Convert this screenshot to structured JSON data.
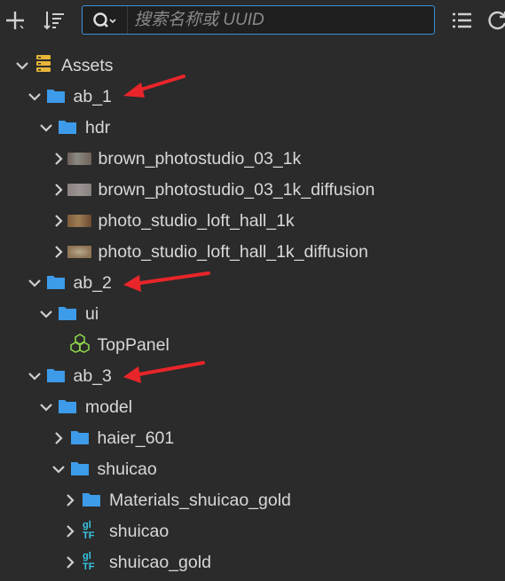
{
  "toolbar": {
    "add_icon": "plus-icon",
    "sort_icon": "sort-icon",
    "search_placeholder": "搜索名称或 UUID",
    "list_icon": "list-icon",
    "refresh_icon": "refresh-icon"
  },
  "colors": {
    "background": "#2b2b2b",
    "folder": "#3d9be9",
    "search_border": "#3c8fd6",
    "annotation_arrow": "#e8252a",
    "prefab": "#8bd34a",
    "gltf": "#37c6e6"
  },
  "tree": [
    {
      "label": "Assets",
      "icon": "database-icon",
      "expanded": true,
      "level": 0
    },
    {
      "label": "ab_1",
      "icon": "folder-icon",
      "expanded": true,
      "level": 1
    },
    {
      "label": "hdr",
      "icon": "folder-icon",
      "expanded": true,
      "level": 2
    },
    {
      "label": "brown_photostudio_03_1k",
      "icon": "image-thumbnail-icon",
      "expanded": false,
      "level": 3
    },
    {
      "label": "brown_photostudio_03_1k_diffusion",
      "icon": "image-thumbnail-icon",
      "expanded": false,
      "level": 3
    },
    {
      "label": "photo_studio_loft_hall_1k",
      "icon": "image-thumbnail-icon",
      "expanded": false,
      "level": 3
    },
    {
      "label": "photo_studio_loft_hall_1k_diffusion",
      "icon": "image-thumbnail-icon",
      "expanded": false,
      "level": 3
    },
    {
      "label": "ab_2",
      "icon": "folder-icon",
      "expanded": true,
      "level": 1
    },
    {
      "label": "ui",
      "icon": "folder-icon",
      "expanded": true,
      "level": 2
    },
    {
      "label": "TopPanel",
      "icon": "prefab-icon",
      "expanded": null,
      "level": 3
    },
    {
      "label": "ab_3",
      "icon": "folder-icon",
      "expanded": true,
      "level": 1
    },
    {
      "label": "model",
      "icon": "folder-icon",
      "expanded": true,
      "level": 2
    },
    {
      "label": "haier_601",
      "icon": "folder-icon",
      "expanded": false,
      "level": 3
    },
    {
      "label": "shuicao",
      "icon": "folder-icon",
      "expanded": true,
      "level": 3
    },
    {
      "label": "Materials_shuicao_gold",
      "icon": "folder-icon",
      "expanded": false,
      "level": 4
    },
    {
      "label": "shuicao",
      "icon": "gltf-icon",
      "expanded": false,
      "level": 4
    },
    {
      "label": "shuicao_gold",
      "icon": "gltf-icon",
      "expanded": false,
      "level": 4
    }
  ]
}
